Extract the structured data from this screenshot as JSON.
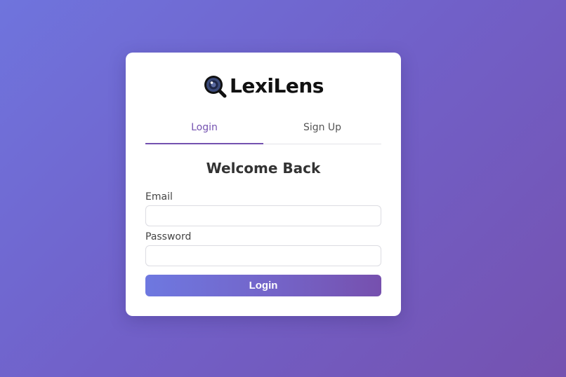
{
  "brand": {
    "name": "LexiLens",
    "icon": "magnifier-eye-icon",
    "accent_color": "#7452b0",
    "background_gradient": [
      "#6f74dd",
      "#7552b0"
    ]
  },
  "tabs": [
    {
      "label": "Login",
      "active": true
    },
    {
      "label": "Sign Up",
      "active": false
    }
  ],
  "form": {
    "heading": "Welcome Back",
    "email_label": "Email",
    "email_value": "",
    "password_label": "Password",
    "password_value": "",
    "submit_label": "Login"
  }
}
